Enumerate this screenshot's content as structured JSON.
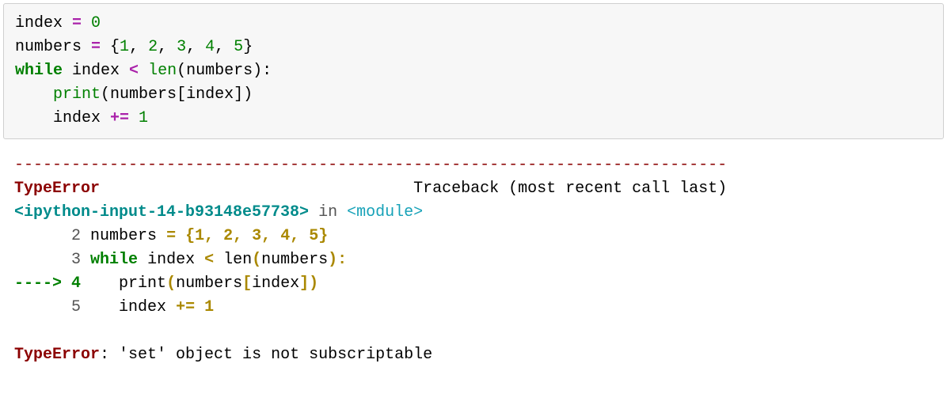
{
  "code": {
    "line1_index": "index",
    "line1_eq": " = ",
    "line1_val": "0",
    "line2_numbers": "numbers",
    "line2_eq": " = ",
    "line2_open": "{",
    "line2_v1": "1",
    "line2_c": ", ",
    "line2_v2": "2",
    "line2_v3": "3",
    "line2_v4": "4",
    "line2_v5": "5",
    "line2_close": "}",
    "line3_while": "while",
    "line3_sp": " ",
    "line3_index": "index",
    "line3_lt": " < ",
    "line3_len": "len",
    "line3_open": "(",
    "line3_numbers": "numbers",
    "line3_close": "):",
    "line4_indent": "    ",
    "line4_print": "print",
    "line4_open": "(",
    "line4_numbers": "numbers",
    "line4_lb": "[",
    "line4_index": "index",
    "line4_rb": "]",
    "line4_close": ")",
    "line5_indent": "    ",
    "line5_index": "index",
    "line5_op": " += ",
    "line5_val": "1"
  },
  "traceback": {
    "separator": "---------------------------------------------------------------------------",
    "error_name": "TypeError",
    "header_spacing": "                                 ",
    "header_text": "Traceback (most recent call last)",
    "location": "<ipython-input-14-b93148e57738>",
    "in_word": " in ",
    "module": "<module>",
    "l2_prefix": "      ",
    "l2_lineno": "2",
    "l2_sp": " ",
    "l2_numbers": "numbers",
    "l2_eq": " = ",
    "l2_open": "{",
    "l2_v1": "1",
    "l2_c": ", ",
    "l2_v2": "2",
    "l2_v3": "3",
    "l2_v4": "4",
    "l2_v5": "5",
    "l2_close": "}",
    "l3_prefix": "      ",
    "l3_lineno": "3",
    "l3_sp": " ",
    "l3_while": "while",
    "l3_ssp": " ",
    "l3_index": "index",
    "l3_lt": " < ",
    "l3_len": "len",
    "l3_open": "(",
    "l3_numbers": "numbers",
    "l3_close": "):",
    "l4_arrow": "----> ",
    "l4_lineno": "4",
    "l4_sp": "    ",
    "l4_print": "print",
    "l4_open": "(",
    "l4_numbers": "numbers",
    "l4_lb": "[",
    "l4_index": "index",
    "l4_rb": "])",
    "l5_prefix": "      ",
    "l5_lineno": "5",
    "l5_sp": "    ",
    "l5_index": "index",
    "l5_op": " += ",
    "l5_val": "1",
    "blank": "",
    "final_err": "TypeError",
    "final_msg": ": 'set' object is not subscriptable"
  }
}
